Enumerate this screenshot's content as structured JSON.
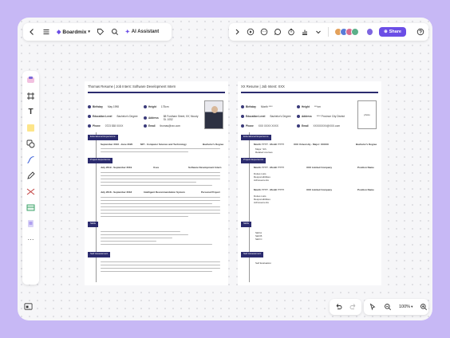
{
  "topbar": {
    "brand": "Boardmix",
    "ai_label": "AI Assistant",
    "share_label": "Share"
  },
  "zoom": "100%",
  "resume1": {
    "header": "Thomas Resume | Job Intent: Software Development Intern",
    "fields": [
      {
        "label": "Birthday",
        "value": "May 1998"
      },
      {
        "label": "Height",
        "value": "175cm"
      },
      {
        "label": "Education Level",
        "value": "Bachelor's Degree"
      },
      {
        "label": "Address",
        "value": "88 Fordham Street, NY, Moody St. 1052"
      },
      {
        "label": "Phone",
        "value": "0723 538 XXXX"
      },
      {
        "label": "Email",
        "value": "thomas@xxx.com"
      }
    ],
    "sections": [
      {
        "title": "Educational Experience"
      },
      {
        "title": "Project Experience"
      },
      {
        "title": "Skills"
      },
      {
        "title": "Self Assessment"
      }
    ],
    "edu_row": {
      "date": "September 2016 - June 2020",
      "school": "MIT - Computer Science and Technology",
      "degree": "Bachelor's Degree"
    },
    "proj_rows": [
      {
        "date": "July 2019 - September 2019",
        "org": "Uses",
        "role": "Software Development Intern"
      },
      {
        "date": "July 2018 - September 2018",
        "org": "Intelligent Recommendation System",
        "role": "Personal Project"
      }
    ]
  },
  "resume2": {
    "header": "XX Resume | Job Intent: XXX",
    "fields": [
      {
        "label": "Birthday",
        "value": "Month ****"
      },
      {
        "label": "Height",
        "value": "***cm"
      },
      {
        "label": "Education Level",
        "value": "Bachelor's Degree"
      },
      {
        "label": "Address",
        "value": "**** Province City District"
      },
      {
        "label": "Phone",
        "value": "XXX XXXX XXXX"
      },
      {
        "label": "Email",
        "value": "XXXXXXXX@XXX.com"
      }
    ],
    "sections": [
      {
        "title": "Educational Experience"
      },
      {
        "title": "Project Experience"
      },
      {
        "title": "Skills"
      },
      {
        "title": "Self Assessment"
      }
    ],
    "edu_row": {
      "date": "Month YYYY - Month YYYY",
      "school": "XXX University - Major: XXXXX",
      "degree": "Bachelor's Degree"
    },
    "proj_rows": [
      {
        "date": "Month YYYY - Month YYYY",
        "org": "XXX Limited Company",
        "role": "Position Name"
      },
      {
        "date": "Month YYYY - Month YYYY",
        "org": "XXX Limited Company",
        "role": "Position Name"
      }
    ],
    "proj_items": [
      "Duties Lists",
      "Responsibilities",
      "Achievements"
    ],
    "edu_items": [
      "Major: Sth.",
      "Related courses"
    ],
    "skills": [
      "Skill A",
      "Skill B",
      "Skill C"
    ],
    "self": "Self Evaluation"
  },
  "photo_label": "photo"
}
